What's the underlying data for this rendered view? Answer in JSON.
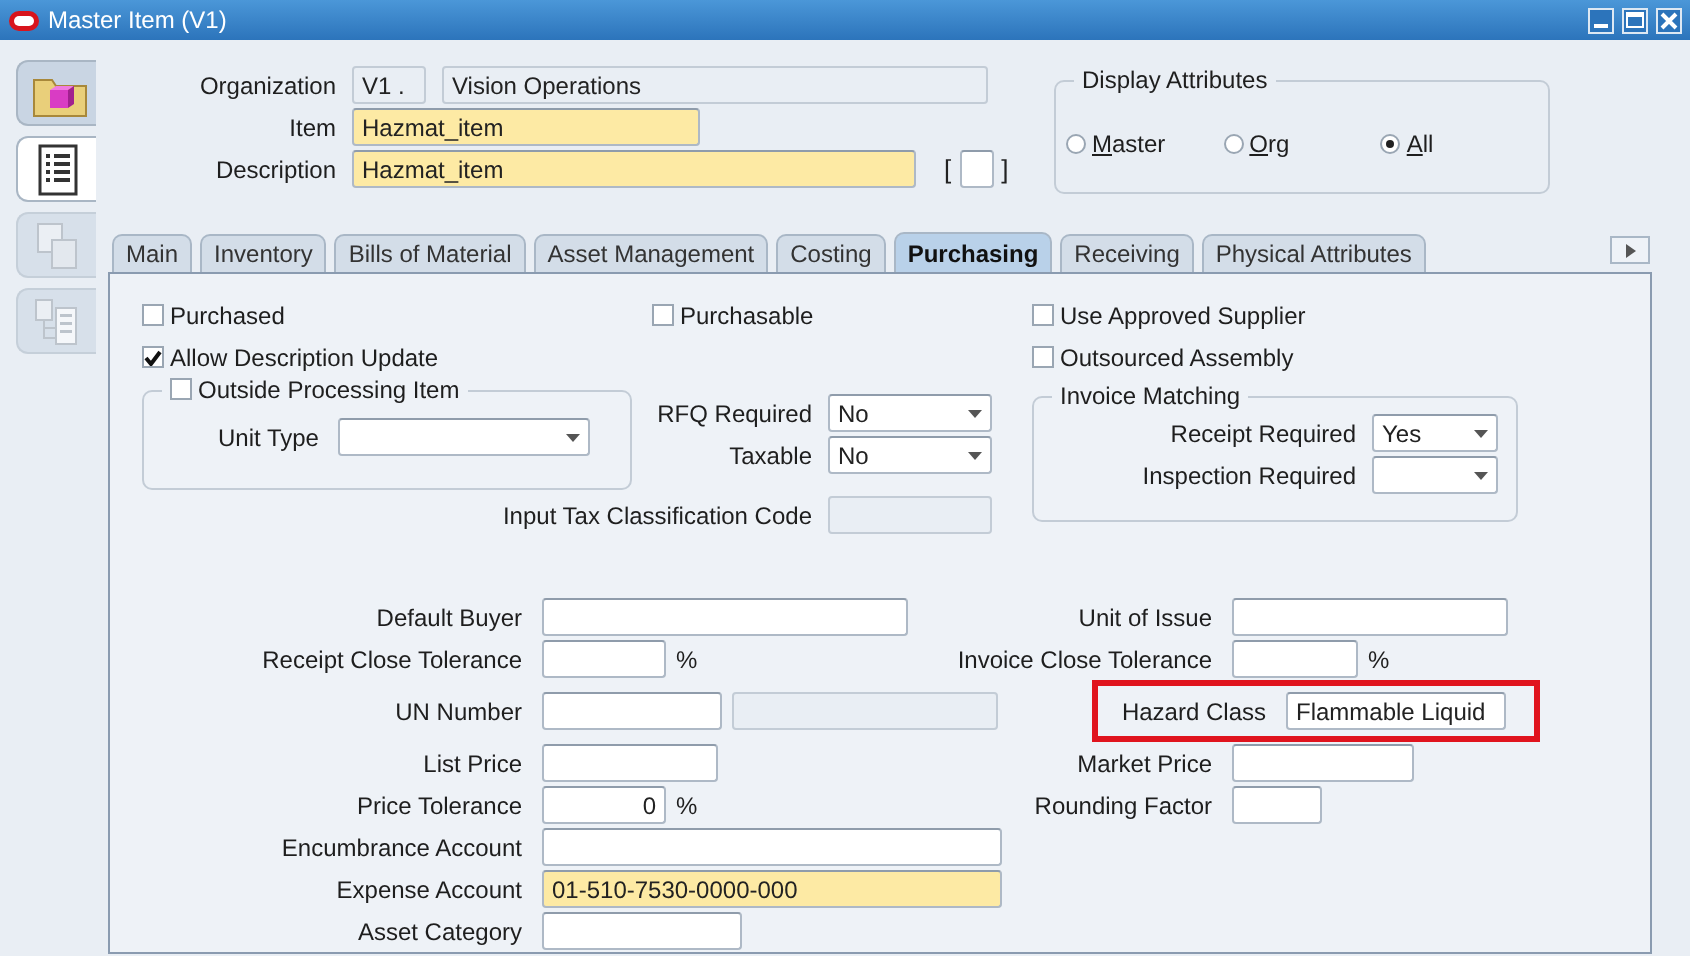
{
  "window": {
    "title": "Master Item (V1)"
  },
  "toolbar": [
    {
      "kind": "folder",
      "selected": false,
      "disabled": false
    },
    {
      "kind": "list",
      "selected": true,
      "disabled": false
    },
    {
      "kind": "documents",
      "selected": false,
      "disabled": true
    },
    {
      "kind": "tree",
      "selected": false,
      "disabled": true
    }
  ],
  "header": {
    "organization": {
      "label": "Organization",
      "code": "V1 .",
      "name": "Vision Operations",
      "disabled": true
    },
    "item": {
      "label": "Item",
      "value": "Hazmat_item",
      "required": true
    },
    "description": {
      "label": "Description",
      "value": "Hazmat_item",
      "required": true,
      "bracket_open": "[",
      "bracket_close": "]"
    }
  },
  "display_attributes": {
    "title": "Display Attributes",
    "options": [
      {
        "label": "Master",
        "selected": false,
        "underline_first": true
      },
      {
        "label": "Org",
        "selected": false,
        "underline_first": true
      },
      {
        "label": "All",
        "selected": true,
        "underline_first": true
      }
    ]
  },
  "tabs": [
    {
      "label": "Main",
      "selected": false
    },
    {
      "label": "Inventory",
      "selected": false
    },
    {
      "label": "Bills of Material",
      "selected": false
    },
    {
      "label": "Asset Management",
      "selected": false
    },
    {
      "label": "Costing",
      "selected": false
    },
    {
      "label": "Purchasing",
      "selected": true
    },
    {
      "label": "Receiving",
      "selected": false
    },
    {
      "label": "Physical Attributes",
      "selected": false
    }
  ],
  "purchasing": {
    "left": {
      "checkboxes": [
        {
          "label": "Purchased",
          "checked": false
        },
        {
          "label": "Allow Description Update",
          "checked": true
        }
      ],
      "outside_processing": {
        "label": "Outside Processing Item",
        "checked": false,
        "unit_type": {
          "label": "Unit Type",
          "kind": "select"
        }
      }
    },
    "middle": {
      "checkboxes": [
        {
          "label": "Purchasable",
          "checked": false
        }
      ],
      "fields": [
        {
          "label": "RFQ Required",
          "value": "No",
          "kind": "select"
        },
        {
          "label": "Taxable",
          "value": "No",
          "kind": "select"
        }
      ]
    },
    "right": {
      "checkboxes": [
        {
          "label": "Use Approved Supplier",
          "checked": false
        },
        {
          "label": "Outsourced Assembly",
          "checked": false
        }
      ],
      "invoice_matching": {
        "title": "Invoice Matching",
        "fields": [
          {
            "label": "Receipt Required",
            "value": "Yes",
            "kind": "select"
          },
          {
            "label": "Inspection Required",
            "kind": "select"
          }
        ]
      }
    },
    "input_tax": {
      "label": "Input Tax Classification Code",
      "disabled": true
    },
    "left_fields": [
      {
        "label": "Default Buyer",
        "required": false,
        "highlighted": false
      },
      {
        "label": "Receipt Close Tolerance",
        "suffix": "%",
        "required": false,
        "highlighted": false
      },
      {
        "label": "UN Number",
        "required": false,
        "highlighted": false,
        "extra_field": {
          "disabled": true
        }
      },
      {
        "label": "List Price",
        "required": false,
        "highlighted": false
      },
      {
        "label": "Price Tolerance",
        "value": "0",
        "suffix": "%",
        "required": false,
        "highlighted": false
      },
      {
        "label": "Encumbrance Account",
        "required": false,
        "highlighted": false
      },
      {
        "label": "Expense Account",
        "value": "01-510-7530-0000-000",
        "required": true,
        "highlighted": false
      },
      {
        "label": "Asset Category",
        "required": false,
        "highlighted": false
      }
    ],
    "right_fields": [
      {
        "label": "Unit of Issue",
        "required": false,
        "highlighted": false
      },
      {
        "label": "Invoice Close Tolerance",
        "suffix": "%",
        "required": false,
        "highlighted": false
      },
      {
        "label": "Hazard Class",
        "value": "Flammable Liquid",
        "required": false,
        "highlighted": true
      },
      {
        "label": "Market Price",
        "required": false,
        "highlighted": false
      },
      {
        "label": "Rounding Factor",
        "required": false,
        "highlighted": false
      }
    ]
  }
}
